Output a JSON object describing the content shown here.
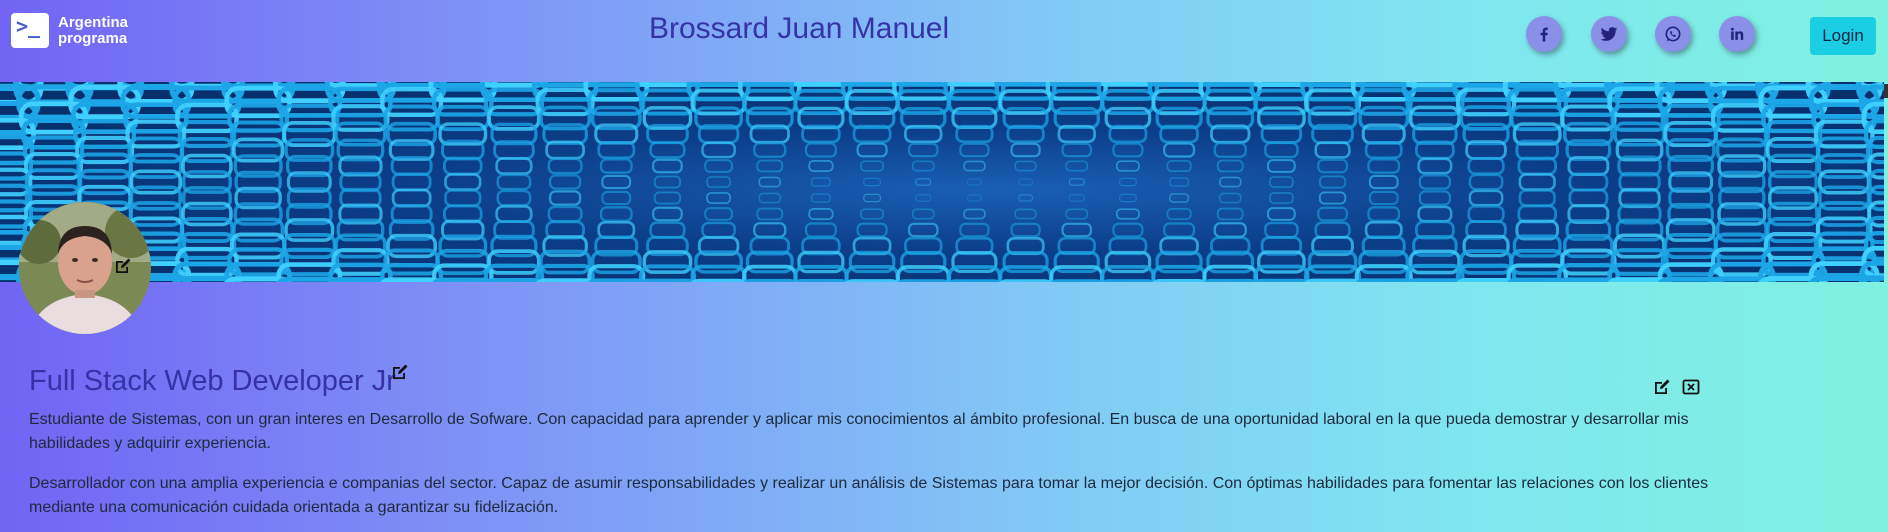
{
  "header": {
    "logo_line1": "Argentina",
    "logo_line2": "programa",
    "logo_glyph": ">_",
    "name": "Brossard Juan Manuel",
    "social": [
      {
        "name": "facebook-icon"
      },
      {
        "name": "twitter-icon"
      },
      {
        "name": "whatsapp-icon"
      },
      {
        "name": "linkedin-icon"
      }
    ],
    "login_label": "Login"
  },
  "profile": {
    "title": "Full Stack Web Developer Jr",
    "paragraph1": "Estudiante de Sistemas, con un gran interes en Desarrollo de Sofware. Con capacidad para aprender y aplicar mis conocimientos al ámbito profesional. En busca de una oportunidad laboral en la que pueda demostrar y desarrollar mis habilidades y adquirir experiencia.",
    "paragraph2": "Desarrollador con una amplia experiencia e companias del sector. Capaz de asumir responsabilidades y realizar un análisis de Sistemas para tomar la mejor decisión. Con óptimas habilidades para fomentar las relaciones con los clientes mediante una comunicación cuidada orientada a garantizar su fidelización."
  },
  "colors": {
    "name_color": "#3732a8",
    "login_bg": "#1ccee3",
    "social_bg": "#8a8fe8",
    "icon_color": "#23237a"
  }
}
